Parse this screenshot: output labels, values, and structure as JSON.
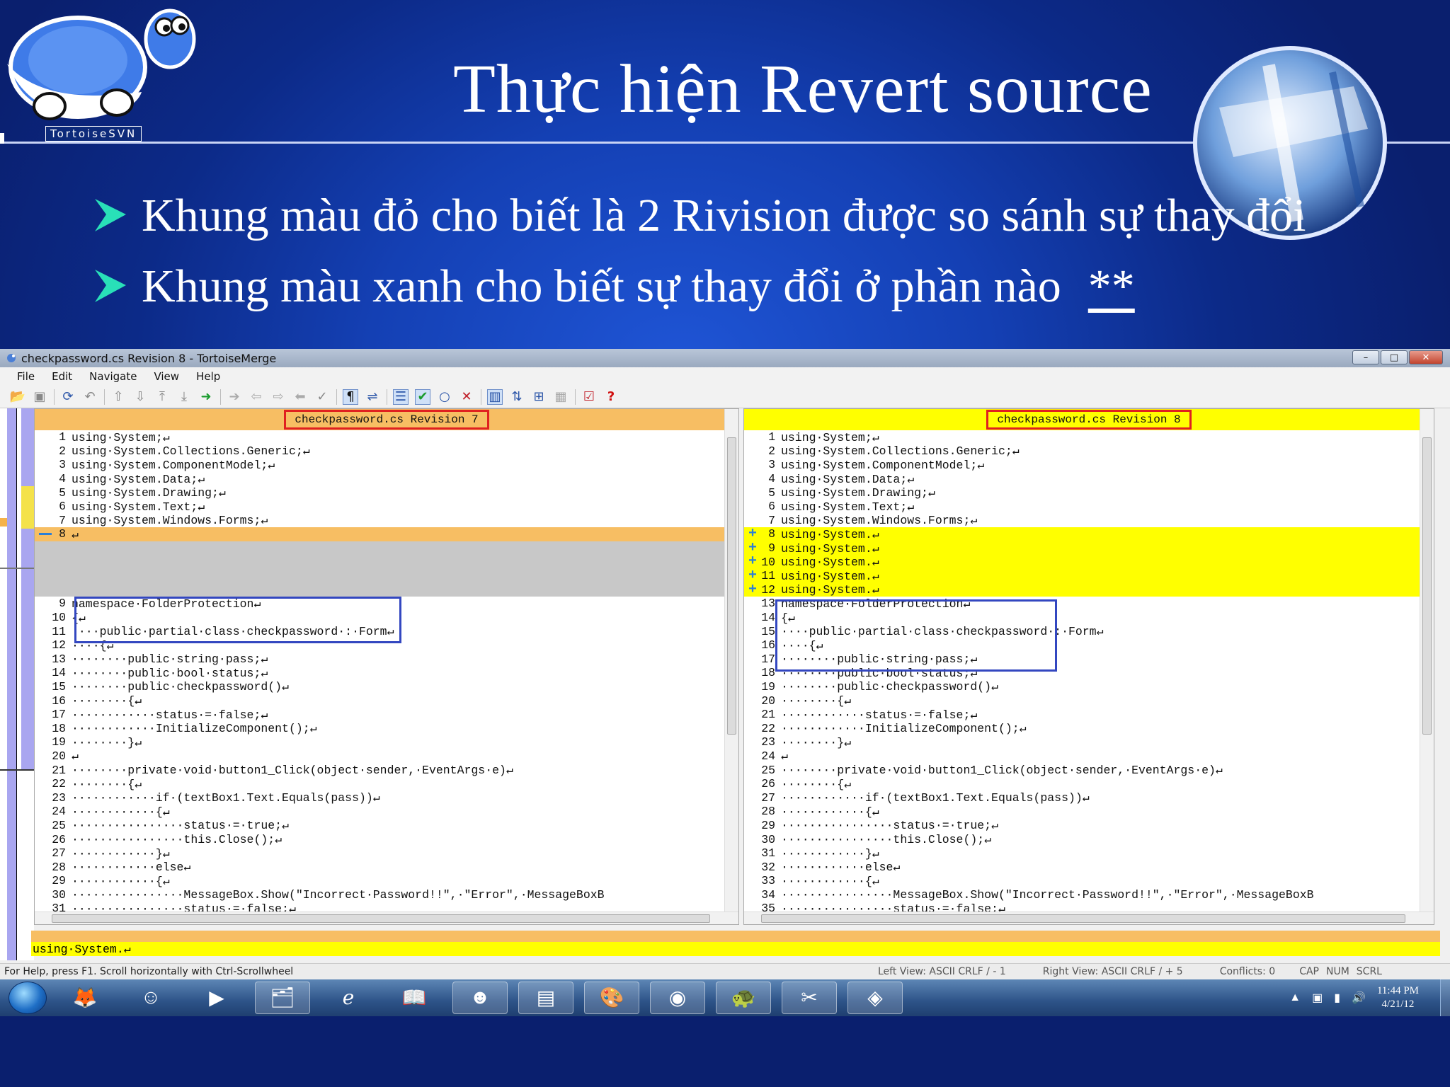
{
  "slide": {
    "title": "Thực hiện Revert source",
    "logo_text": "TortoiseSVN",
    "bullets": [
      {
        "text": "Khung màu đỏ cho biết là 2 Rivision được so sánh sự thay đổi",
        "marker": ""
      },
      {
        "text": "Khung màu xanh cho biết sự thay đổi ở phần nào",
        "marker": "**"
      }
    ]
  },
  "window": {
    "title": "checkpassword.cs Revision 8 - TortoiseMerge",
    "controls": {
      "minimize": "–",
      "maximize": "□",
      "close": "✕"
    },
    "menu": [
      "File",
      "Edit",
      "Navigate",
      "View",
      "Help"
    ],
    "toolbar_icons": [
      "open-icon",
      "save-icon",
      "reload-icon",
      "undo-icon",
      "prev-diff-icon",
      "next-diff-icon",
      "first-diff-icon",
      "last-diff-icon",
      "next-conflict-icon",
      "prev-inline-icon",
      "next-inline-icon",
      "prev-change-icon",
      "next-change-icon",
      "mark-icon",
      "whitespace-icon",
      "wrap-icon",
      "one-pane-icon",
      "mark-resolved-icon",
      "circle-icon",
      "close-x-icon",
      "two-pane-icon",
      "swap-icon",
      "settings-icon",
      "stop-icon",
      "check-icon",
      "help-icon"
    ],
    "left_pane": {
      "header": "checkpassword.cs Revision 7",
      "lines": [
        {
          "n": "1",
          "t": "using·System;↵"
        },
        {
          "n": "2",
          "t": "using·System.Collections.Generic;↵"
        },
        {
          "n": "3",
          "t": "using·System.ComponentModel;↵"
        },
        {
          "n": "4",
          "t": "using·System.Data;↵"
        },
        {
          "n": "5",
          "t": "using·System.Drawing;↵"
        },
        {
          "n": "6",
          "t": "using·System.Text;↵"
        },
        {
          "n": "7",
          "t": "using·System.Windows.Forms;↵"
        },
        {
          "n": "8",
          "t": "↵"
        },
        {
          "n": "",
          "t": ""
        },
        {
          "n": "",
          "t": ""
        },
        {
          "n": "",
          "t": ""
        },
        {
          "n": "",
          "t": ""
        },
        {
          "n": "9",
          "t": "namespace·FolderProtection↵"
        },
        {
          "n": "10",
          "t": "{↵"
        },
        {
          "n": "11",
          "t": "····public·partial·class·checkpassword·:·Form↵"
        },
        {
          "n": "12",
          "t": "····{↵"
        },
        {
          "n": "13",
          "t": "········public·string·pass;↵"
        },
        {
          "n": "14",
          "t": "········public·bool·status;↵"
        },
        {
          "n": "15",
          "t": "········public·checkpassword()↵"
        },
        {
          "n": "16",
          "t": "········{↵"
        },
        {
          "n": "17",
          "t": "············status·=·false;↵"
        },
        {
          "n": "18",
          "t": "············InitializeComponent();↵"
        },
        {
          "n": "19",
          "t": "········}↵"
        },
        {
          "n": "20",
          "t": "↵"
        },
        {
          "n": "21",
          "t": "········private·void·button1_Click(object·sender,·EventArgs·e)↵"
        },
        {
          "n": "22",
          "t": "········{↵"
        },
        {
          "n": "23",
          "t": "············if·(textBox1.Text.Equals(pass))↵"
        },
        {
          "n": "24",
          "t": "············{↵"
        },
        {
          "n": "25",
          "t": "················status·=·true;↵"
        },
        {
          "n": "26",
          "t": "················this.Close();↵"
        },
        {
          "n": "27",
          "t": "············}↵"
        },
        {
          "n": "28",
          "t": "············else↵"
        },
        {
          "n": "29",
          "t": "············{↵"
        },
        {
          "n": "30",
          "t": "················MessageBox.Show(\"Incorrect·Password!!\",·\"Error\",·MessageBoxB"
        },
        {
          "n": "31",
          "t": "················status·=·false;↵"
        }
      ]
    },
    "right_pane": {
      "header": "checkpassword.cs Revision 8",
      "lines": [
        {
          "n": "1",
          "t": "using·System;↵"
        },
        {
          "n": "2",
          "t": "using·System.Collections.Generic;↵"
        },
        {
          "n": "3",
          "t": "using·System.ComponentModel;↵"
        },
        {
          "n": "4",
          "t": "using·System.Data;↵"
        },
        {
          "n": "5",
          "t": "using·System.Drawing;↵"
        },
        {
          "n": "6",
          "t": "using·System.Text;↵"
        },
        {
          "n": "7",
          "t": "using·System.Windows.Forms;↵"
        },
        {
          "n": "8",
          "t": "using·System.↵"
        },
        {
          "n": "9",
          "t": "using·System.↵"
        },
        {
          "n": "10",
          "t": "using·System.↵"
        },
        {
          "n": "11",
          "t": "using·System.↵"
        },
        {
          "n": "12",
          "t": "using·System.↵"
        },
        {
          "n": "13",
          "t": "namespace·FolderProtection↵"
        },
        {
          "n": "14",
          "t": "{↵"
        },
        {
          "n": "15",
          "t": "····public·partial·class·checkpassword·:·Form↵"
        },
        {
          "n": "16",
          "t": "····{↵"
        },
        {
          "n": "17",
          "t": "········public·string·pass;↵"
        },
        {
          "n": "18",
          "t": "········public·bool·status;↵"
        },
        {
          "n": "19",
          "t": "········public·checkpassword()↵"
        },
        {
          "n": "20",
          "t": "········{↵"
        },
        {
          "n": "21",
          "t": "············status·=·false;↵"
        },
        {
          "n": "22",
          "t": "············InitializeComponent();↵"
        },
        {
          "n": "23",
          "t": "········}↵"
        },
        {
          "n": "24",
          "t": "↵"
        },
        {
          "n": "25",
          "t": "········private·void·button1_Click(object·sender,·EventArgs·e)↵"
        },
        {
          "n": "26",
          "t": "········{↵"
        },
        {
          "n": "27",
          "t": "············if·(textBox1.Text.Equals(pass))↵"
        },
        {
          "n": "28",
          "t": "············{↵"
        },
        {
          "n": "29",
          "t": "················status·=·true;↵"
        },
        {
          "n": "30",
          "t": "················this.Close();↵"
        },
        {
          "n": "31",
          "t": "············}↵"
        },
        {
          "n": "32",
          "t": "············else↵"
        },
        {
          "n": "33",
          "t": "············{↵"
        },
        {
          "n": "34",
          "t": "················MessageBox.Show(\"Incorrect·Password!!\",·\"Error\",·MessageBoxB"
        },
        {
          "n": "35",
          "t": "················status·=·false;↵"
        }
      ]
    },
    "bottom_line": "using·System.↵",
    "status": {
      "help": "For Help, press F1. Scroll horizontally with Ctrl-Scrollwheel",
      "left_view": "Left View: ASCII CRLF  / - 1",
      "right_view": "Right View: ASCII CRLF  / + 5",
      "conflicts": "Conflicts: 0",
      "cap": "CAP",
      "num": "NUM",
      "scrl": "SCRL"
    }
  },
  "taskbar": {
    "apps": [
      "firefox-icon",
      "yahoo-messenger-icon",
      "media-player-icon",
      "file-explorer-icon",
      "internet-explorer-icon",
      "reader-icon",
      "yahoo-icon",
      "powerpoint-icon",
      "paint-icon",
      "chrome-icon",
      "tortoise-icon",
      "snipping-icon",
      "tortoisemerge-icon"
    ],
    "time": "11:44 PM",
    "date": "4/21/12"
  },
  "colors": {
    "slide_bg": "#1440b4",
    "left_header": "#f7be63",
    "right_header": "#ffff00",
    "red_frame": "#e02020",
    "blue_frame": "#3347c0"
  }
}
